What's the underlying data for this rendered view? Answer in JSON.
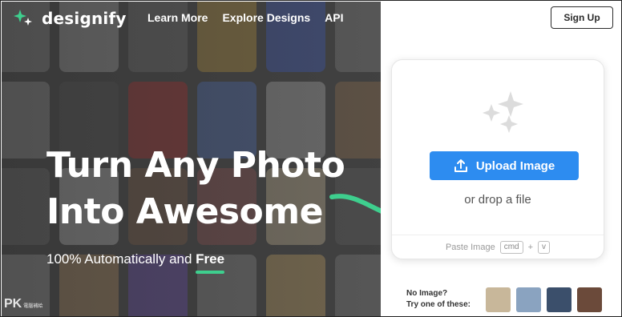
{
  "brand": {
    "name": "designify"
  },
  "nav": {
    "items": [
      {
        "label": "Learn More"
      },
      {
        "label": "Explore Designs"
      },
      {
        "label": "API"
      }
    ]
  },
  "signup_label": "Sign Up",
  "hero": {
    "line1": "Turn Any Photo",
    "line2": "Into Awesome",
    "sub_prefix": "100% Automatically and ",
    "sub_free": "Free"
  },
  "upload": {
    "button_label": "Upload Image",
    "drop_text": "or drop a file",
    "paste_label": "Paste Image",
    "key_cmd": "cmd",
    "plus": "+",
    "key_v": "v"
  },
  "samples": {
    "line1": "No Image?",
    "line2": "Try one of these:",
    "thumbs": [
      {
        "color": "#c8b79a"
      },
      {
        "color": "#8aa3c0"
      },
      {
        "color": "#3b4f6b"
      },
      {
        "color": "#6b4a3a"
      }
    ]
  },
  "watermark": {
    "text": "PK",
    "small": "電腦補給"
  },
  "colors": {
    "accent_blue": "#2d8cf0",
    "accent_green": "#3ecf8e",
    "tiles": [
      "#9c9c9c",
      "#b9b9b9",
      "#7e7e7e",
      "#c9a24a",
      "#4a66c8",
      "#8a8a8a",
      "#a8a8a8",
      "#5f5f5f",
      "#c23a3a",
      "#5a7cc8",
      "#b8b8b8",
      "#9b7b5a",
      "#7a7a7a",
      "#cfcfcf",
      "#8d6b52",
      "#a06060",
      "#d2c2a0",
      "#6a6a6a",
      "#b0b0b0",
      "#c8a070",
      "#7b5ac8",
      "#9a9a9a",
      "#d0b070",
      "#8a8a8a"
    ]
  }
}
